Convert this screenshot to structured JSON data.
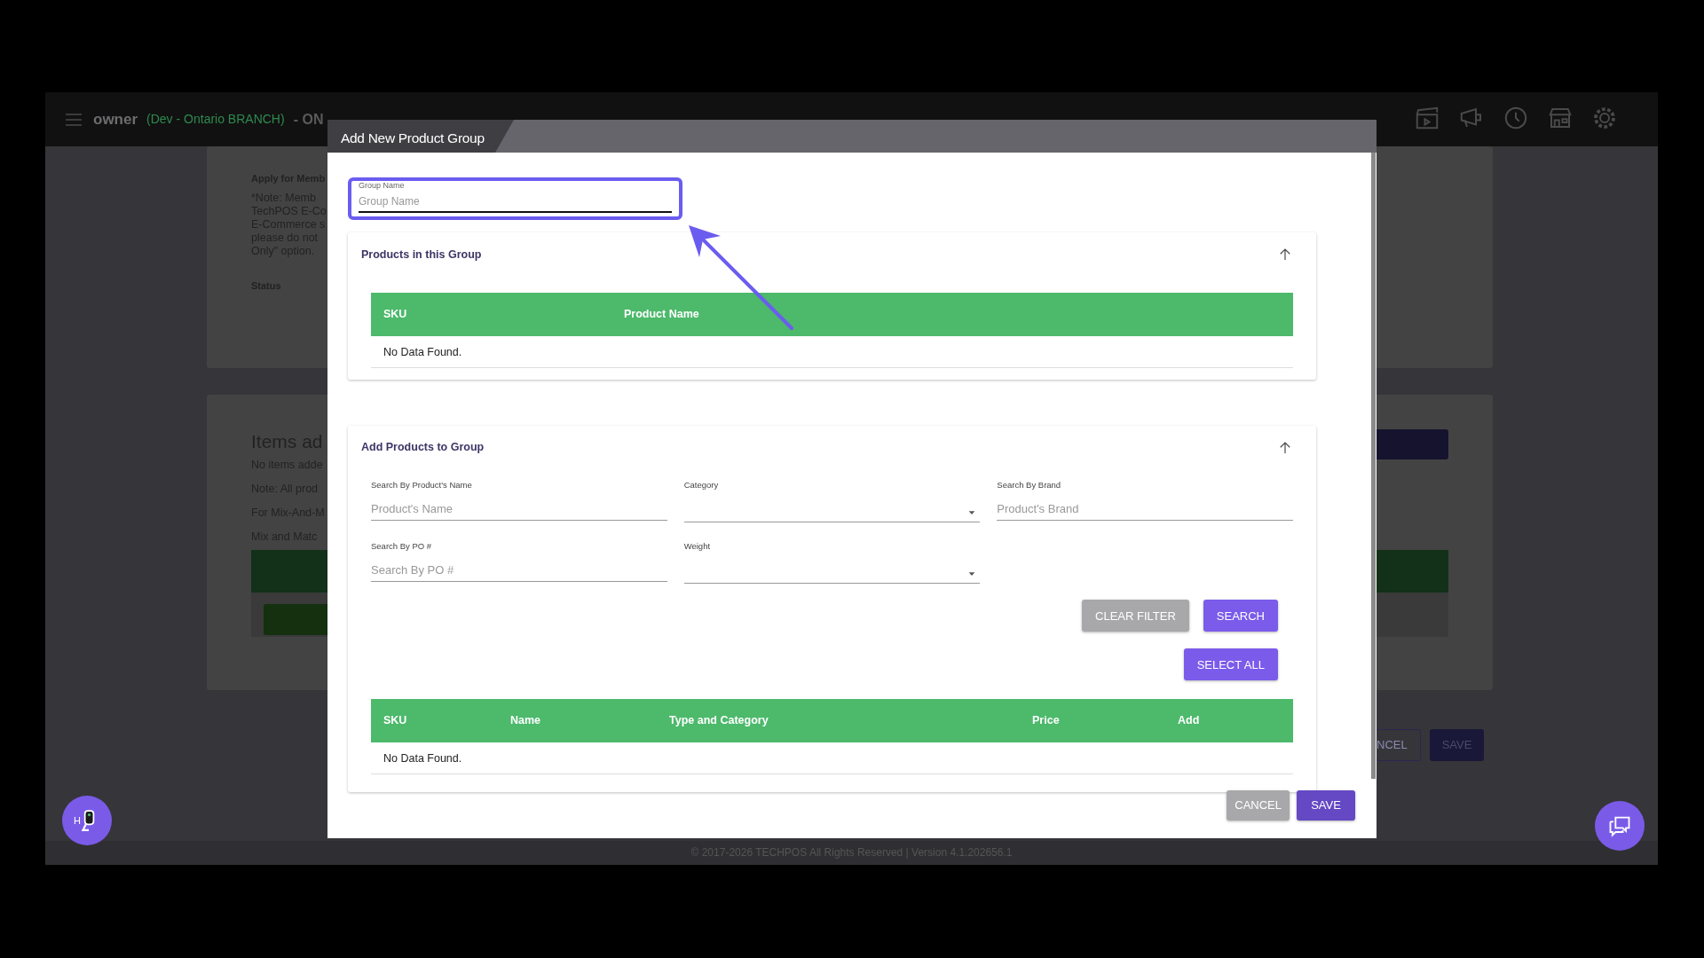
{
  "header": {
    "user": "owner",
    "branch": "(Dev - Ontario BRANCH)",
    "status": "- ON"
  },
  "background": {
    "card1": {
      "heading": "Apply for Memb",
      "note_lines": [
        "*Note: Memb",
        "TechPOS E-Co",
        "E-Commerce s",
        "please do not",
        "Only\" option."
      ],
      "status_label": "Status"
    },
    "card2": {
      "title": "Items ad",
      "lines": [
        "No items adde",
        "Note: All prod",
        "For Mix-And-M",
        "Mix and Matc"
      ]
    },
    "buttons": [
      {
        "label": "NCEL",
        "kind": "outline"
      },
      {
        "label": "SAVE",
        "kind": "primary"
      }
    ]
  },
  "modal": {
    "title": "Add New Product Group",
    "group_name": {
      "label": "Group Name",
      "placeholder": "Group Name"
    },
    "products_section": {
      "title": "Products in this Group",
      "columns": [
        "SKU",
        "Product Name"
      ],
      "empty_text": "No Data Found."
    },
    "add_section": {
      "title": "Add Products to Group",
      "filters": [
        {
          "kind": "text",
          "label": "Search By Product's Name",
          "placeholder": "Product's Name"
        },
        {
          "kind": "select",
          "label": "Category"
        },
        {
          "kind": "text",
          "label": "Search By Brand",
          "placeholder": "Product's Brand"
        },
        {
          "kind": "text",
          "label": "Search By PO #",
          "placeholder": "Search By PO #"
        },
        {
          "kind": "select",
          "label": "Weight"
        }
      ],
      "filter_buttons": [
        {
          "label": "CLEAR FILTER",
          "kind": "secondary"
        },
        {
          "label": "SEARCH",
          "kind": "primary"
        }
      ],
      "select_all": "SELECT ALL",
      "columns": [
        "SKU",
        "Name",
        "Type and Category",
        "Price",
        "Add"
      ],
      "empty_text": "No Data Found."
    },
    "footer_buttons": [
      {
        "label": "CANCEL",
        "kind": "secondary"
      },
      {
        "label": "SAVE",
        "kind": "dark"
      }
    ]
  },
  "help_badge": "H",
  "footer": "© 2017-2026 TECHPOS All Rights Reserved | Version 4.1.202656.1"
}
